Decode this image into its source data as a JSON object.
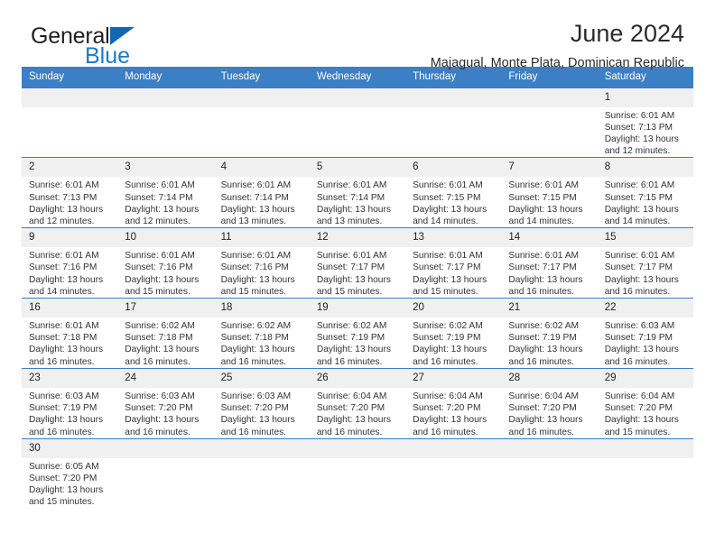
{
  "brand": {
    "word_general": "General",
    "word_blue": "Blue",
    "accent_color": "#1b79c8",
    "triangle_color": "#1268b3"
  },
  "header": {
    "title": "June 2024",
    "subtitle": "Majagual, Monte Plata, Dominican Republic",
    "header_bg": "#3b7fc4",
    "daynum_bg": "#f0f0f0"
  },
  "weekdays": [
    "Sunday",
    "Monday",
    "Tuesday",
    "Wednesday",
    "Thursday",
    "Friday",
    "Saturday"
  ],
  "labels": {
    "sunrise": "Sunrise:",
    "sunset": "Sunset:",
    "daylight": "Daylight:"
  },
  "weeks": [
    [
      {
        "day": "",
        "blank": true
      },
      {
        "day": "",
        "blank": true
      },
      {
        "day": "",
        "blank": true
      },
      {
        "day": "",
        "blank": true
      },
      {
        "day": "",
        "blank": true
      },
      {
        "day": "",
        "blank": true
      },
      {
        "day": "1",
        "sunrise": "Sunrise: 6:01 AM",
        "sunset": "Sunset: 7:13 PM",
        "daylight1": "Daylight: 13 hours",
        "daylight2": "and 12 minutes."
      }
    ],
    [
      {
        "day": "2",
        "sunrise": "Sunrise: 6:01 AM",
        "sunset": "Sunset: 7:13 PM",
        "daylight1": "Daylight: 13 hours",
        "daylight2": "and 12 minutes."
      },
      {
        "day": "3",
        "sunrise": "Sunrise: 6:01 AM",
        "sunset": "Sunset: 7:14 PM",
        "daylight1": "Daylight: 13 hours",
        "daylight2": "and 12 minutes."
      },
      {
        "day": "4",
        "sunrise": "Sunrise: 6:01 AM",
        "sunset": "Sunset: 7:14 PM",
        "daylight1": "Daylight: 13 hours",
        "daylight2": "and 13 minutes."
      },
      {
        "day": "5",
        "sunrise": "Sunrise: 6:01 AM",
        "sunset": "Sunset: 7:14 PM",
        "daylight1": "Daylight: 13 hours",
        "daylight2": "and 13 minutes."
      },
      {
        "day": "6",
        "sunrise": "Sunrise: 6:01 AM",
        "sunset": "Sunset: 7:15 PM",
        "daylight1": "Daylight: 13 hours",
        "daylight2": "and 14 minutes."
      },
      {
        "day": "7",
        "sunrise": "Sunrise: 6:01 AM",
        "sunset": "Sunset: 7:15 PM",
        "daylight1": "Daylight: 13 hours",
        "daylight2": "and 14 minutes."
      },
      {
        "day": "8",
        "sunrise": "Sunrise: 6:01 AM",
        "sunset": "Sunset: 7:15 PM",
        "daylight1": "Daylight: 13 hours",
        "daylight2": "and 14 minutes."
      }
    ],
    [
      {
        "day": "9",
        "sunrise": "Sunrise: 6:01 AM",
        "sunset": "Sunset: 7:16 PM",
        "daylight1": "Daylight: 13 hours",
        "daylight2": "and 14 minutes."
      },
      {
        "day": "10",
        "sunrise": "Sunrise: 6:01 AM",
        "sunset": "Sunset: 7:16 PM",
        "daylight1": "Daylight: 13 hours",
        "daylight2": "and 15 minutes."
      },
      {
        "day": "11",
        "sunrise": "Sunrise: 6:01 AM",
        "sunset": "Sunset: 7:16 PM",
        "daylight1": "Daylight: 13 hours",
        "daylight2": "and 15 minutes."
      },
      {
        "day": "12",
        "sunrise": "Sunrise: 6:01 AM",
        "sunset": "Sunset: 7:17 PM",
        "daylight1": "Daylight: 13 hours",
        "daylight2": "and 15 minutes."
      },
      {
        "day": "13",
        "sunrise": "Sunrise: 6:01 AM",
        "sunset": "Sunset: 7:17 PM",
        "daylight1": "Daylight: 13 hours",
        "daylight2": "and 15 minutes."
      },
      {
        "day": "14",
        "sunrise": "Sunrise: 6:01 AM",
        "sunset": "Sunset: 7:17 PM",
        "daylight1": "Daylight: 13 hours",
        "daylight2": "and 16 minutes."
      },
      {
        "day": "15",
        "sunrise": "Sunrise: 6:01 AM",
        "sunset": "Sunset: 7:17 PM",
        "daylight1": "Daylight: 13 hours",
        "daylight2": "and 16 minutes."
      }
    ],
    [
      {
        "day": "16",
        "sunrise": "Sunrise: 6:01 AM",
        "sunset": "Sunset: 7:18 PM",
        "daylight1": "Daylight: 13 hours",
        "daylight2": "and 16 minutes."
      },
      {
        "day": "17",
        "sunrise": "Sunrise: 6:02 AM",
        "sunset": "Sunset: 7:18 PM",
        "daylight1": "Daylight: 13 hours",
        "daylight2": "and 16 minutes."
      },
      {
        "day": "18",
        "sunrise": "Sunrise: 6:02 AM",
        "sunset": "Sunset: 7:18 PM",
        "daylight1": "Daylight: 13 hours",
        "daylight2": "and 16 minutes."
      },
      {
        "day": "19",
        "sunrise": "Sunrise: 6:02 AM",
        "sunset": "Sunset: 7:19 PM",
        "daylight1": "Daylight: 13 hours",
        "daylight2": "and 16 minutes."
      },
      {
        "day": "20",
        "sunrise": "Sunrise: 6:02 AM",
        "sunset": "Sunset: 7:19 PM",
        "daylight1": "Daylight: 13 hours",
        "daylight2": "and 16 minutes."
      },
      {
        "day": "21",
        "sunrise": "Sunrise: 6:02 AM",
        "sunset": "Sunset: 7:19 PM",
        "daylight1": "Daylight: 13 hours",
        "daylight2": "and 16 minutes."
      },
      {
        "day": "22",
        "sunrise": "Sunrise: 6:03 AM",
        "sunset": "Sunset: 7:19 PM",
        "daylight1": "Daylight: 13 hours",
        "daylight2": "and 16 minutes."
      }
    ],
    [
      {
        "day": "23",
        "sunrise": "Sunrise: 6:03 AM",
        "sunset": "Sunset: 7:19 PM",
        "daylight1": "Daylight: 13 hours",
        "daylight2": "and 16 minutes."
      },
      {
        "day": "24",
        "sunrise": "Sunrise: 6:03 AM",
        "sunset": "Sunset: 7:20 PM",
        "daylight1": "Daylight: 13 hours",
        "daylight2": "and 16 minutes."
      },
      {
        "day": "25",
        "sunrise": "Sunrise: 6:03 AM",
        "sunset": "Sunset: 7:20 PM",
        "daylight1": "Daylight: 13 hours",
        "daylight2": "and 16 minutes."
      },
      {
        "day": "26",
        "sunrise": "Sunrise: 6:04 AM",
        "sunset": "Sunset: 7:20 PM",
        "daylight1": "Daylight: 13 hours",
        "daylight2": "and 16 minutes."
      },
      {
        "day": "27",
        "sunrise": "Sunrise: 6:04 AM",
        "sunset": "Sunset: 7:20 PM",
        "daylight1": "Daylight: 13 hours",
        "daylight2": "and 16 minutes."
      },
      {
        "day": "28",
        "sunrise": "Sunrise: 6:04 AM",
        "sunset": "Sunset: 7:20 PM",
        "daylight1": "Daylight: 13 hours",
        "daylight2": "and 16 minutes."
      },
      {
        "day": "29",
        "sunrise": "Sunrise: 6:04 AM",
        "sunset": "Sunset: 7:20 PM",
        "daylight1": "Daylight: 13 hours",
        "daylight2": "and 15 minutes."
      }
    ],
    [
      {
        "day": "30",
        "sunrise": "Sunrise: 6:05 AM",
        "sunset": "Sunset: 7:20 PM",
        "daylight1": "Daylight: 13 hours",
        "daylight2": "and 15 minutes."
      },
      {
        "day": "",
        "blank": true
      },
      {
        "day": "",
        "blank": true
      },
      {
        "day": "",
        "blank": true
      },
      {
        "day": "",
        "blank": true
      },
      {
        "day": "",
        "blank": true
      },
      {
        "day": "",
        "blank": true
      }
    ]
  ]
}
